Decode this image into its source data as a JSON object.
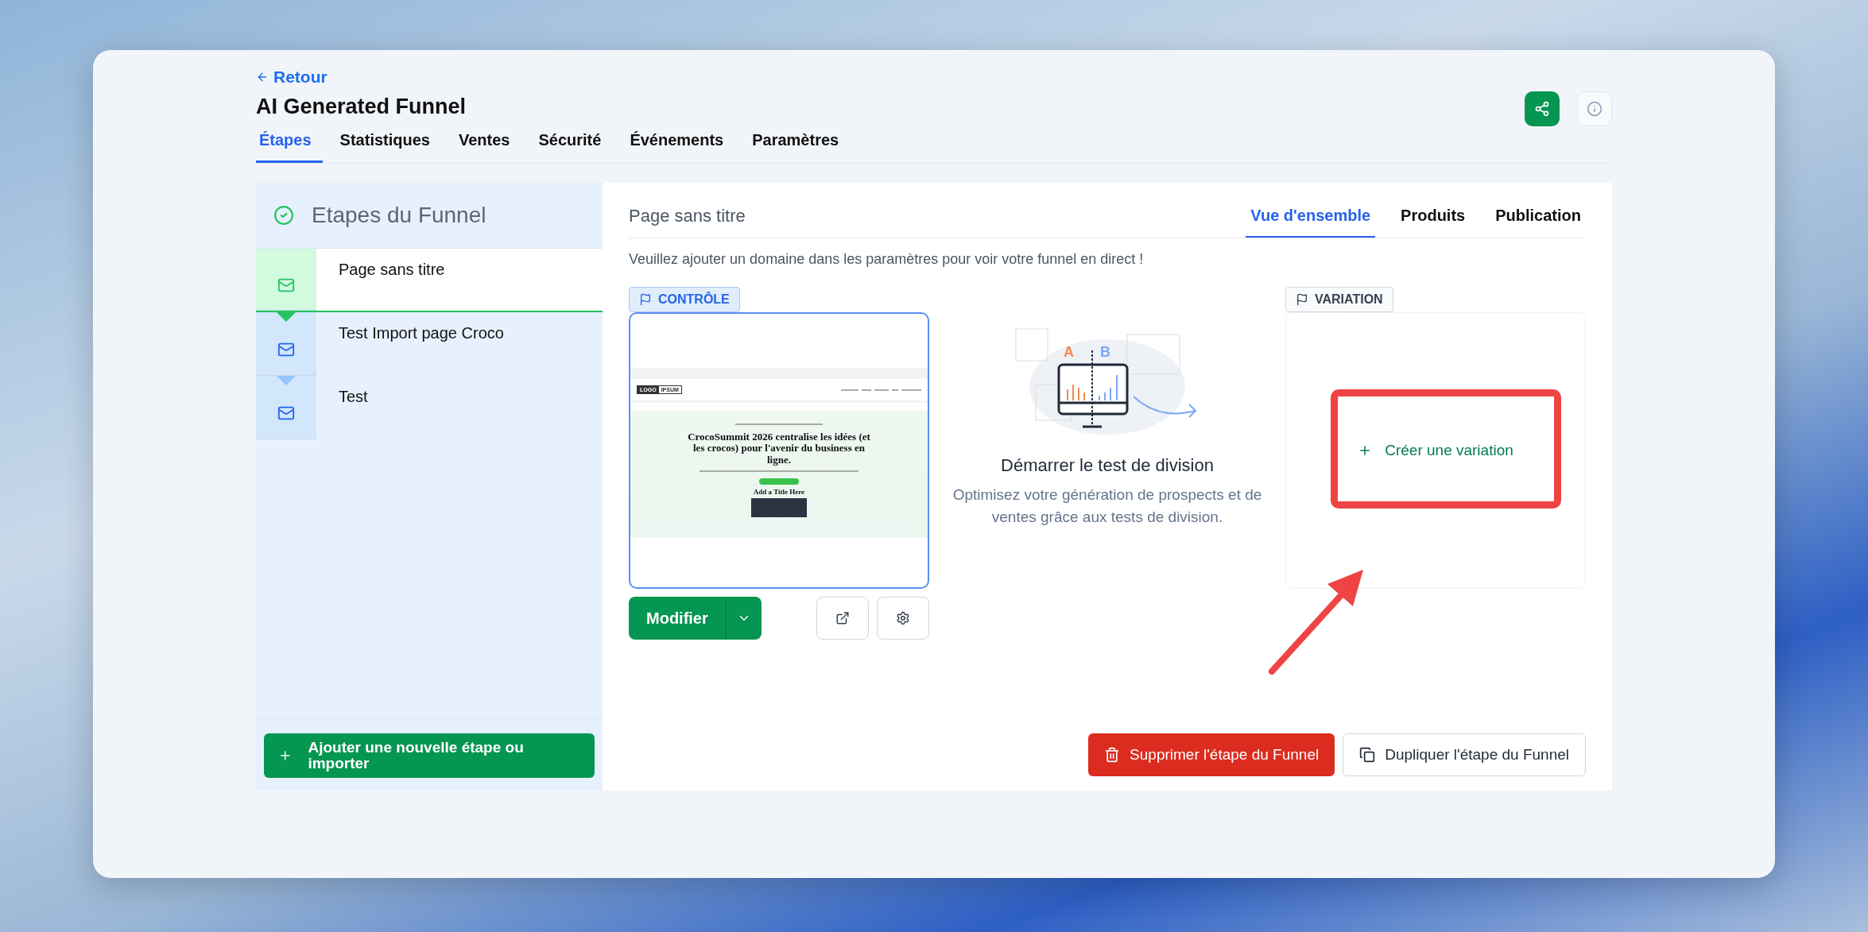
{
  "back_link": "Retour",
  "title": "AI Generated Funnel",
  "tabs": [
    {
      "label": "Étapes",
      "selected": true
    },
    {
      "label": "Statistiques",
      "selected": false
    },
    {
      "label": "Ventes",
      "selected": false
    },
    {
      "label": "Sécurité",
      "selected": false
    },
    {
      "label": "Événements",
      "selected": false
    },
    {
      "label": "Paramètres",
      "selected": false
    }
  ],
  "sidebar": {
    "title": "Etapes du Funnel",
    "steps": [
      {
        "label": "Page sans titre",
        "selected": true
      },
      {
        "label": "Test Import page Croco",
        "selected": false
      },
      {
        "label": "Test",
        "selected": false
      }
    ],
    "add_button": "Ajouter une nouvelle étape ou importer"
  },
  "page": {
    "title": "Page sans titre",
    "tabs": [
      {
        "label": "Vue d'ensemble",
        "selected": true
      },
      {
        "label": "Produits",
        "selected": false
      },
      {
        "label": "Publication",
        "selected": false
      }
    ],
    "notice": "Veuillez ajouter un domaine dans les paramètres pour voir votre funnel en direct !",
    "control": {
      "label": "CONTRÔLE",
      "preview": {
        "logo": [
          "LOGO",
          "IPSUM"
        ],
        "headline": "CrocoSummit 2026 centralise les idées (et les crocos) pour l'avenir du business en ligne.",
        "section_title": "Add a Title Here"
      },
      "edit_button": "Modifier"
    },
    "split_test": {
      "labels": [
        "A",
        "B"
      ],
      "title": "Démarrer le test de division",
      "description": "Optimisez votre génération de prospects et de ventes grâce aux tests de division."
    },
    "variation": {
      "label": "VARIATION",
      "create_button": "Créer une variation"
    },
    "delete_button": "Supprimer l'étape du Funnel",
    "duplicate_button": "Dupliquer l'étape du Funnel"
  }
}
